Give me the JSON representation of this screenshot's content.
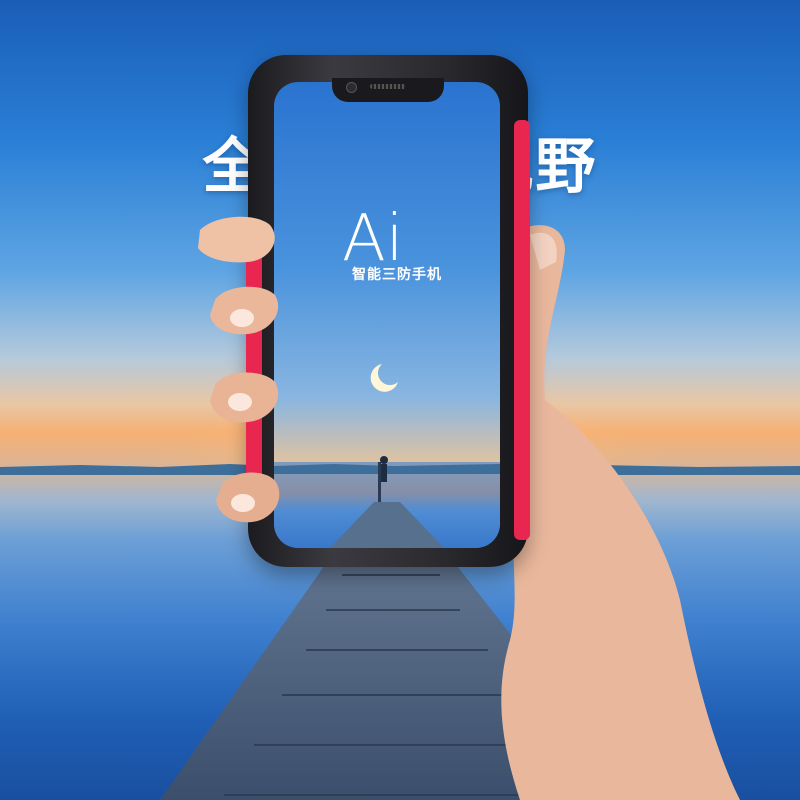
{
  "headline": "全面屏 大视野",
  "screen": {
    "logo_text": "Ai",
    "tagline": "智能三防手机"
  },
  "colors": {
    "sky_top": "#1a5db7",
    "water": "#1f5fb5",
    "bumper_accent": "#e8264f",
    "headline_text": "#ffffff"
  },
  "icons": [
    "front-camera-icon",
    "earpiece-speaker-icon",
    "moon-icon"
  ]
}
